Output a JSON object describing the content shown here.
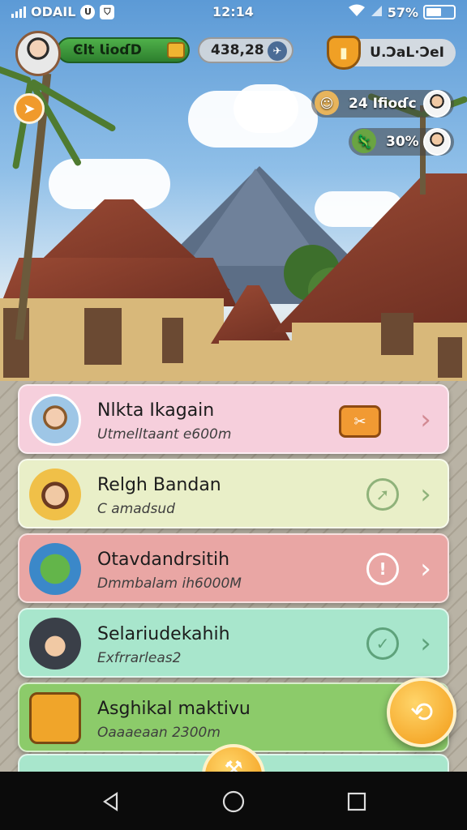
{
  "status_bar": {
    "carrier": "ODAIL",
    "time": "12:14",
    "battery": "57%",
    "battery_level": 0.57,
    "icons": [
      "signal-bars-icon",
      "carrier-badge-icon",
      "shield-status-icon",
      "wifi-icon",
      "cell-signal-icon",
      "battery-icon"
    ]
  },
  "hud": {
    "player_label": "Ͼlt ƖioɗD",
    "coins": "438,28",
    "rank_label": "U.ƆaL·ƆeI",
    "stats": [
      {
        "value": "24 Ifioɗc",
        "icon": "worker-icon"
      },
      {
        "value": "30%",
        "icon": "lizard-icon"
      }
    ]
  },
  "quests": [
    {
      "title": "Nlkta Ikagain",
      "subtitle": "Utmelltaant e600m",
      "status_icon": "scroll-ticket-icon",
      "color": "#f6cfdc",
      "accent": "#d28a93"
    },
    {
      "title": "Relgh Bandan",
      "subtitle": "C amadsud",
      "status_icon": "compass-icon",
      "color": "#e9efc8",
      "accent": "#8fb27a"
    },
    {
      "title": "Otavdandrsitih",
      "subtitle": "Dmmbalam ih6000M",
      "status_icon": "timer-icon",
      "color": "#e9a6a4",
      "accent": "#ffffff"
    },
    {
      "title": "Selariudekahih",
      "subtitle": "Exfrrarleas2",
      "status_icon": "check-icon",
      "color": "#a8e6cc",
      "accent": "#5ea27b"
    },
    {
      "title": "Asghikal maktivu",
      "subtitle": "Oaaaeaan 2300m",
      "status_icon": "",
      "color": "#8ccb6a",
      "accent": "#3d7d2c"
    }
  ],
  "actions": {
    "fab_icon": "cycle-arrows-icon",
    "fab2_icon": "hammer-icon"
  },
  "nav": [
    "back-icon",
    "home-icon",
    "recents-icon"
  ]
}
